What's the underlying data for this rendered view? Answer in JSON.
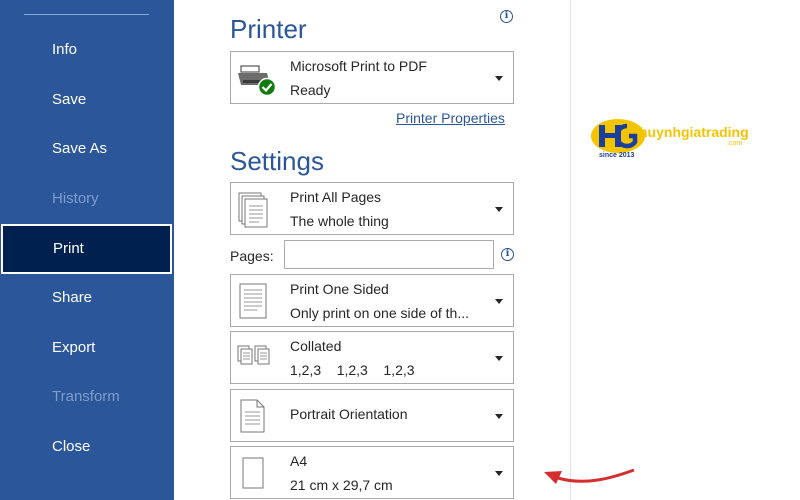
{
  "sidebar": {
    "items": [
      {
        "label": "Info",
        "state": "normal"
      },
      {
        "label": "Save",
        "state": "normal"
      },
      {
        "label": "Save As",
        "state": "normal"
      },
      {
        "label": "History",
        "state": "disabled"
      },
      {
        "label": "Print",
        "state": "active"
      },
      {
        "label": "Share",
        "state": "normal"
      },
      {
        "label": "Export",
        "state": "normal"
      },
      {
        "label": "Transform",
        "state": "disabled"
      },
      {
        "label": "Close",
        "state": "normal"
      }
    ]
  },
  "printer": {
    "heading": "Printer",
    "name": "Microsoft Print to PDF",
    "status": "Ready",
    "properties_link": "Printer Properties"
  },
  "settings": {
    "heading": "Settings",
    "print_range": {
      "line1": "Print All Pages",
      "line2": "The whole thing"
    },
    "pages": {
      "label": "Pages:",
      "value": ""
    },
    "sides": {
      "line1": "Print One Sided",
      "line2": "Only print on one side of th..."
    },
    "collation": {
      "line1": "Collated",
      "line2": "1,2,3    1,2,3    1,2,3"
    },
    "orientation": {
      "line1": "Portrait Orientation"
    },
    "paper": {
      "line1": "A4",
      "line2": "21 cm x 29,7 cm"
    }
  },
  "watermark": {
    "brand": "huynhgiatrading",
    "domain": ".com",
    "since": "since 2013"
  },
  "colors": {
    "sidebar": "#2b579a",
    "sidebar_active": "#002050",
    "accent": "#2b579a",
    "arrow": "#d32f2f",
    "logo_yellow": "#f5c400",
    "logo_blue": "#1a3f9c"
  }
}
